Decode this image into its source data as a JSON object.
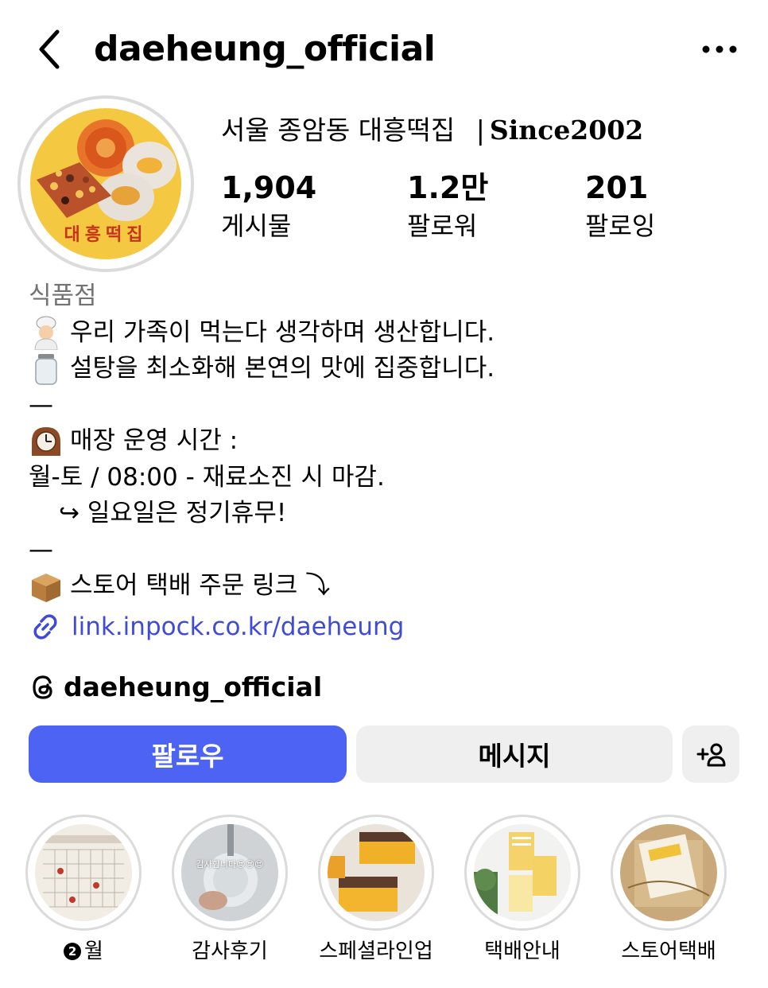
{
  "header": {
    "username": "daeheung_official",
    "back_icon": "chevron-left-icon",
    "more_icon": "more-horizontal-icon"
  },
  "profile": {
    "avatar_text": "대흥떡집",
    "display_name": "서울 종암동 대흥떡집",
    "display_name_since": "Since2002",
    "display_name_separator": "|"
  },
  "stats": [
    {
      "value": "1,904",
      "label": "게시물"
    },
    {
      "value": "1.2만",
      "label": "팔로워"
    },
    {
      "value": "201",
      "label": "팔로잉"
    }
  ],
  "bio": {
    "category": "식품점",
    "line1": "우리 가족이 먹는다 생각하며 생산합니다.",
    "line2": "설탕을 최소화해 본연의 맛에 집중합니다.",
    "divider1": "—",
    "hours_title": "매장 운영 시간 :",
    "hours": "월-토 / 08:00 - 재료소진 시 마감.",
    "closed": "↪ 일요일은 정기휴무!",
    "divider2": "—",
    "store_line": "스토어 택배 주문 링크 ⤵",
    "link": "link.inpock.co.kr/daeheung"
  },
  "threads": {
    "handle": "daeheung_official"
  },
  "buttons": {
    "follow": "팔로우",
    "message": "메시지",
    "add_user": "+8"
  },
  "highlights": [
    {
      "label": "월",
      "badge": "2"
    },
    {
      "label": "감사후기",
      "overlay_text": "감사합니다😍😍😍"
    },
    {
      "label": "스페셜라인업"
    },
    {
      "label": "택배안내"
    },
    {
      "label": "스토어택배"
    }
  ],
  "colors": {
    "follow_button": "#4d63f4",
    "link": "#3f4bd6",
    "category": "#737373",
    "secondary_button": "#efefef",
    "avatar_bg": "#f5c842"
  }
}
